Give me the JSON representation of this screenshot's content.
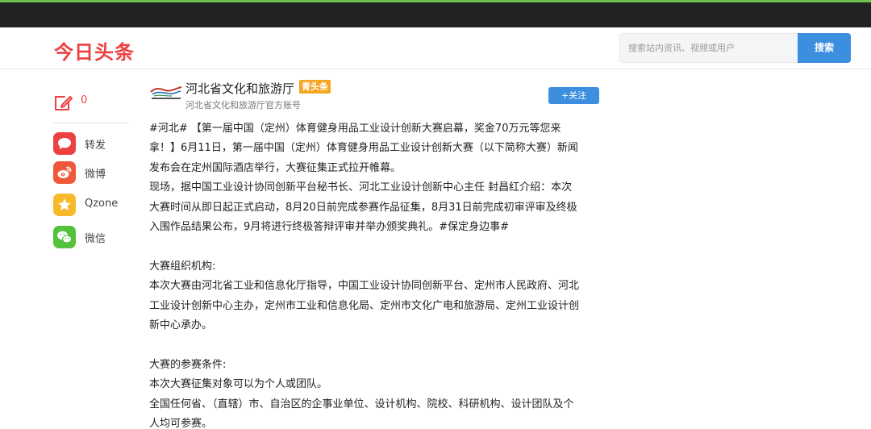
{
  "header": {
    "logo": "今日头条",
    "search_placeholder": "搜索站内资讯、视频或用户",
    "search_button": "搜索"
  },
  "colors": {
    "topbar": "#222222",
    "topbar_accent": "#6fc24a",
    "brand_red": "#ed4040",
    "primary_blue": "#3c8fde",
    "badge_orange": "#f5a623"
  },
  "sidebar": {
    "comment_count": "0",
    "share_items": [
      {
        "label": "转发",
        "icon": "chat-bubble-icon",
        "color": "#ed4040"
      },
      {
        "label": "微博",
        "icon": "weibo-icon",
        "color": "#f0583a"
      },
      {
        "label": "Qzone",
        "icon": "star-icon",
        "color": "#f6b92b"
      },
      {
        "label": "微信",
        "icon": "wechat-icon",
        "color": "#54c23d"
      }
    ]
  },
  "author": {
    "name": "河北省文化和旅游厅",
    "badge": "青头条",
    "description": "河北省文化和旅游厅官方账号",
    "follow_label": "+关注"
  },
  "article": {
    "lines": [
      "#河北# 【第一届中国（定州）体育健身用品工业设计创新大赛启幕，奖金70万元等您来",
      "拿！】6月11日，第一届中国（定州）体育健身用品工业设计创新大赛（以下简称大赛）新闻",
      "发布会在定州国际酒店举行，大赛征集正式拉开帷幕。",
      "现场，据中国工业设计协同创新平台秘书长、河北工业设计创新中心主任 封昌红介绍：本次",
      "大赛时间从即日起正式启动，8月20日前完成参赛作品征集，8月31日前完成初审评审及终极",
      "入围作品结果公布，9月将进行终极答辩评审并举办颁奖典礼。#保定身边事#",
      "",
      "大赛组织机构:",
      "本次大赛由河北省工业和信息化厅指导，中国工业设计协同创新平台、定州市人民政府、河北",
      "工业设计创新中心主办，定州市工业和信息化局、定州市文化广电和旅游局、定州工业设计创",
      "新中心承办。",
      "",
      "大赛的参赛条件:",
      "本次大赛征集对象可以为个人或团队。",
      "全国任何省、（直辖）市、自治区的企事业单位、设计机构、院校、科研机构、设计团队及个",
      "人均可参赛。"
    ]
  }
}
